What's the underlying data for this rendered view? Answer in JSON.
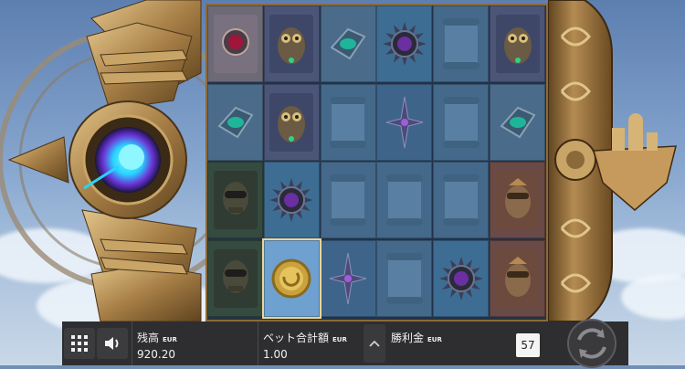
{
  "grid": {
    "rows": 4,
    "cols": 6,
    "symbols": [
      [
        "ruby-gem-icon",
        "owl-icon",
        "emerald-gem-icon",
        "violet-sun-gem-icon",
        "scroll-icon",
        "owl-icon"
      ],
      [
        "emerald-gem-icon",
        "owl-icon",
        "scroll-icon",
        "compass-star-icon",
        "scroll-icon",
        "emerald-gem-icon"
      ],
      [
        "aviator-icon",
        "violet-sun-gem-icon",
        "scroll-icon",
        "scroll-icon",
        "scroll-icon",
        "warrior-icon"
      ],
      [
        "aviator-icon",
        "golden-compass-icon",
        "compass-star-icon",
        "scroll-icon",
        "violet-sun-gem-icon",
        "warrior-icon"
      ]
    ],
    "highlighted": [
      [
        3,
        1
      ]
    ]
  },
  "colors": {
    "accent_blue": "#29d3ff",
    "frame_gold": "#a57d45",
    "bar_bg": "#2e2e30"
  },
  "bottom_bar": {
    "menu_icon": "grid-menu-icon",
    "sound_icon": "speaker-icon",
    "balance_label": "残高",
    "balance_currency": "EUR",
    "balance_value": "920.20",
    "bet_label": "ベット合計額",
    "bet_currency": "EUR",
    "bet_value": "1.00",
    "expand_icon": "chevron-up-icon",
    "win_label": "勝利金",
    "win_currency": "EUR",
    "autoplay_count": "57",
    "spin_icon": "spin-arrows-icon"
  }
}
